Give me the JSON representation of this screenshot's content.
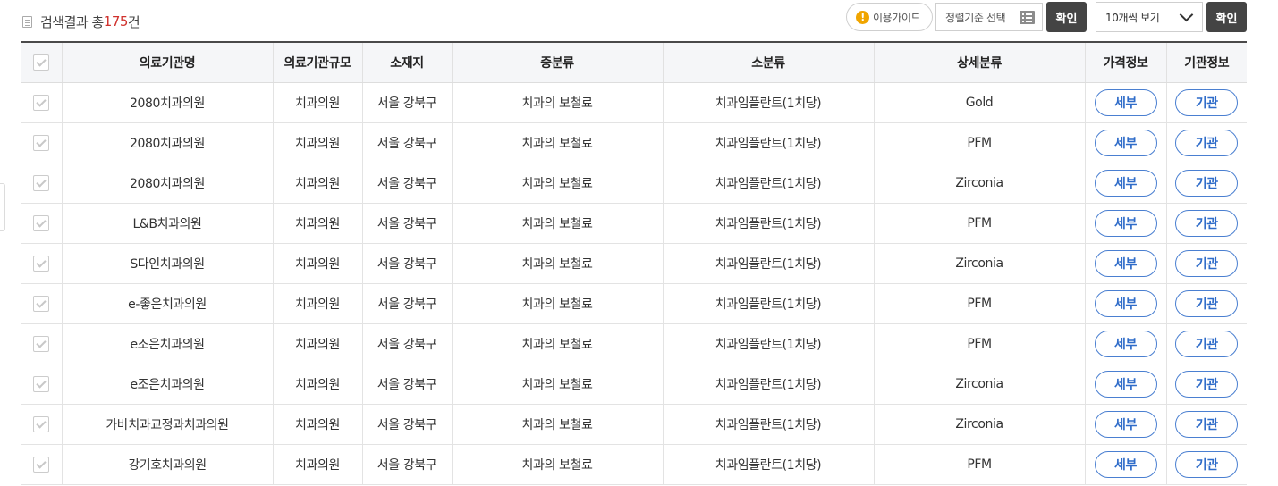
{
  "result": {
    "prefix": "검색결과 총",
    "count": "175",
    "suffix": "건"
  },
  "toolbar": {
    "guide_label": "이용가이드",
    "sort_placeholder": "정렬기준 선택",
    "confirm_label": "확인",
    "page_size": "10개씩 보기",
    "confirm2_label": "확인"
  },
  "table": {
    "headers": [
      "",
      "의료기관명",
      "의료기관규모",
      "소재지",
      "중분류",
      "소분류",
      "상세분류",
      "가격정보",
      "기관정보"
    ],
    "detail_label": "세부",
    "org_label": "기관",
    "rows": [
      {
        "name": "2080치과의원",
        "size": "치과의원",
        "location": "서울 강북구",
        "mid": "치과의 보철료",
        "sub": "치과임플란트(1치당)",
        "detail": "Gold"
      },
      {
        "name": "2080치과의원",
        "size": "치과의원",
        "location": "서울 강북구",
        "mid": "치과의 보철료",
        "sub": "치과임플란트(1치당)",
        "detail": "PFM"
      },
      {
        "name": "2080치과의원",
        "size": "치과의원",
        "location": "서울 강북구",
        "mid": "치과의 보철료",
        "sub": "치과임플란트(1치당)",
        "detail": "Zirconia"
      },
      {
        "name": "L&B치과의원",
        "size": "치과의원",
        "location": "서울 강북구",
        "mid": "치과의 보철료",
        "sub": "치과임플란트(1치당)",
        "detail": "PFM"
      },
      {
        "name": "S다인치과의원",
        "size": "치과의원",
        "location": "서울 강북구",
        "mid": "치과의 보철료",
        "sub": "치과임플란트(1치당)",
        "detail": "Zirconia"
      },
      {
        "name": "e-좋은치과의원",
        "size": "치과의원",
        "location": "서울 강북구",
        "mid": "치과의 보철료",
        "sub": "치과임플란트(1치당)",
        "detail": "PFM"
      },
      {
        "name": "e조은치과의원",
        "size": "치과의원",
        "location": "서울 강북구",
        "mid": "치과의 보철료",
        "sub": "치과임플란트(1치당)",
        "detail": "PFM"
      },
      {
        "name": "e조은치과의원",
        "size": "치과의원",
        "location": "서울 강북구",
        "mid": "치과의 보철료",
        "sub": "치과임플란트(1치당)",
        "detail": "Zirconia"
      },
      {
        "name": "가바치과교정과치과의원",
        "size": "치과의원",
        "location": "서울 강북구",
        "mid": "치과의 보철료",
        "sub": "치과임플란트(1치당)",
        "detail": "Zirconia"
      },
      {
        "name": "강기호치과의원",
        "size": "치과의원",
        "location": "서울 강북구",
        "mid": "치과의 보철료",
        "sub": "치과임플란트(1치당)",
        "detail": "PFM"
      }
    ]
  }
}
